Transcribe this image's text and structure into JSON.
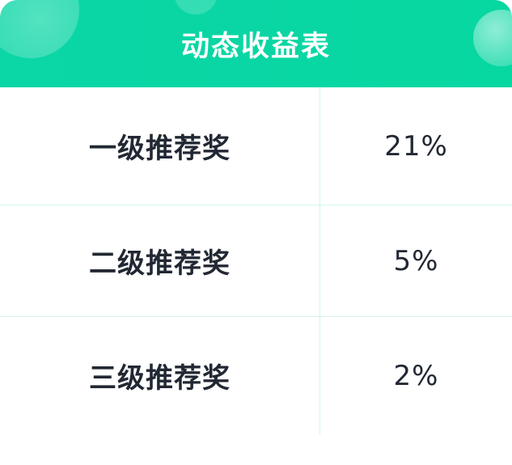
{
  "header": {
    "title": "动态收益表"
  },
  "table": {
    "rows": [
      {
        "label": "一级推荐奖",
        "value": "21%"
      },
      {
        "label": "二级推荐奖",
        "value": "5%"
      },
      {
        "label": "三级推荐奖",
        "value": "2%"
      }
    ]
  },
  "colors": {
    "header_green": "#0bd6a6",
    "divider": "#d4f4ea",
    "text": "#222833"
  }
}
